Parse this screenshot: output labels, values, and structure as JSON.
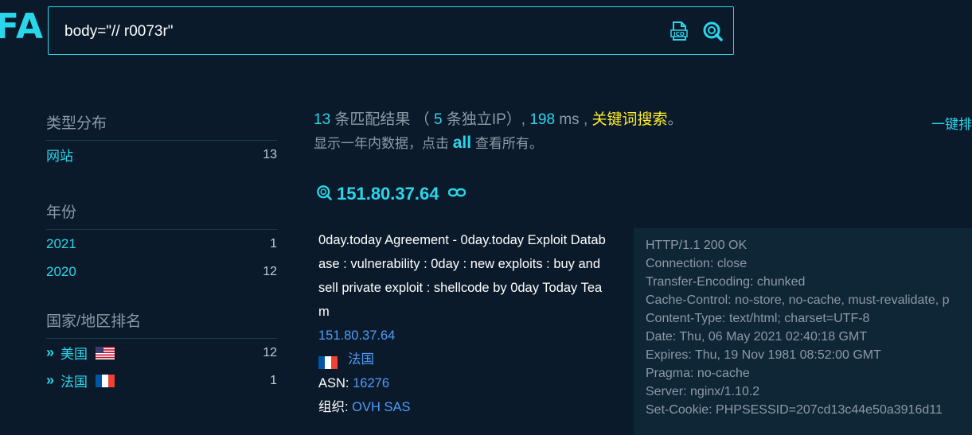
{
  "logo": {
    "text": "FA"
  },
  "search": {
    "value": "body=\"// r0073r\""
  },
  "sidebar": {
    "sections": [
      {
        "title": "类型分布",
        "items": [
          {
            "label": "网站",
            "count": "13"
          }
        ]
      },
      {
        "title": "年份",
        "items": [
          {
            "label": "2021",
            "count": "1"
          },
          {
            "label": "2020",
            "count": "12"
          }
        ]
      },
      {
        "title": "国家/地区排名",
        "items": [
          {
            "label": "美国",
            "count": "12",
            "flag": "us-flag"
          },
          {
            "label": "法国",
            "count": "1",
            "flag": "fr-flag"
          }
        ]
      }
    ]
  },
  "summary": {
    "count": "13",
    "count_suffix": " 条匹配结果 （",
    "ips": "5",
    "ips_suffix": " 条独立IP）,",
    "ms": "198",
    "ms_suffix": " ms ,",
    "keyword": "关键词搜索",
    "period": "。",
    "line2_prefix": "显示一年内数据，点击 ",
    "all": "all",
    "line2_suffix": " 查看所有。",
    "one_key": "一键排"
  },
  "result": {
    "ip": "151.80.37.64",
    "title": "0day.today Agreement - 0day.today Exploit Database : vulnerability : 0day : new exploits : buy and sell private exploit : shellcode by 0day Today Team",
    "ip_link": "151.80.37.64",
    "country": "法国",
    "asn_label": "ASN: ",
    "asn": "16276",
    "org_label": "组织: ",
    "org": "OVH SAS",
    "headers": [
      "HTTP/1.1 200 OK",
      "Connection: close",
      "Transfer-Encoding: chunked",
      "Cache-Control: no-store, no-cache, must-revalidate, p",
      "Content-Type: text/html; charset=UTF-8",
      "Date: Thu, 06 May 2021 02:40:18 GMT",
      "Expires: Thu, 19 Nov 1981 08:52:00 GMT",
      "Pragma: no-cache",
      "Server: nginx/1.10.2",
      "Set-Cookie: PHPSESSID=207cd13c44e50a3916d11"
    ]
  },
  "colors": {
    "accent": "#2ad6ea",
    "link": "#4f9cf7",
    "keyword": "#ffef2a",
    "background": "#0b1a2b"
  }
}
